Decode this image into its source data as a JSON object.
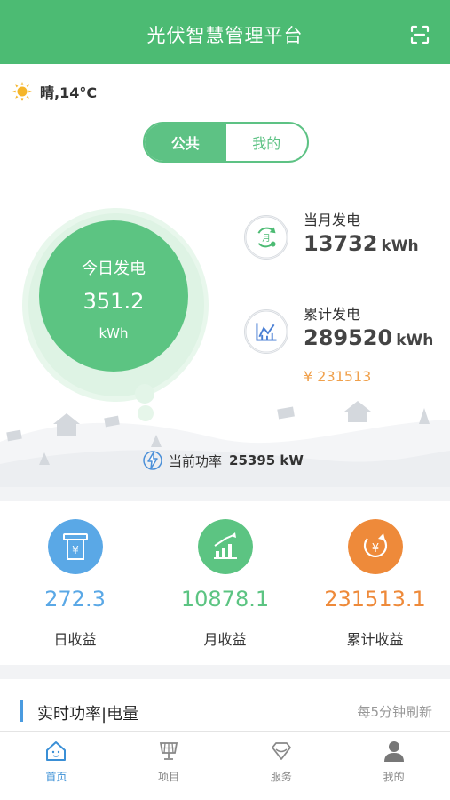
{
  "header": {
    "title": "光伏智慧管理平台",
    "scan_icon": "scan-icon"
  },
  "weather": {
    "icon": "sun-icon",
    "text": "晴,14°C"
  },
  "toggle": {
    "public_label": "公共",
    "mine_label": "我的",
    "active": "公共"
  },
  "today": {
    "label": "今日发电",
    "value": "351.2",
    "unit": "kWh"
  },
  "month_gen": {
    "icon": "calendar-month-icon",
    "label": "当月发电",
    "value": "13732",
    "unit": "kWh"
  },
  "total_gen": {
    "icon": "line-chart-icon",
    "label": "累计发电",
    "value": "289520",
    "unit": "kWh",
    "money": "¥ 231513"
  },
  "power": {
    "icon": "lightning-icon",
    "label": "当前功率",
    "value": "25395 kW"
  },
  "earnings": [
    {
      "icon": "atm-yen-icon",
      "value": "272.3",
      "label": "日收益",
      "color": "#5aa8e6"
    },
    {
      "icon": "bar-chart-up-icon",
      "value": "10878.1",
      "label": "月收益",
      "color": "#5cc482"
    },
    {
      "icon": "coin-cycle-icon",
      "value": "231513.1",
      "label": "累计收益",
      "color": "#ee8a3a"
    }
  ],
  "realtime": {
    "title": "实时功率|电量",
    "note": "每5分钟刷新"
  },
  "nav": [
    {
      "icon": "home-icon",
      "label": "首页",
      "active": true
    },
    {
      "icon": "solar-panel-icon",
      "label": "项目",
      "active": false
    },
    {
      "icon": "diamond-icon",
      "label": "服务",
      "active": false
    },
    {
      "icon": "user-icon",
      "label": "我的",
      "active": false
    }
  ],
  "colors": {
    "brand": "#4cbb73",
    "accent_green": "#5cc482",
    "blue": "#5aa8e6",
    "orange": "#ee8a3a",
    "money": "#f0a04b"
  }
}
